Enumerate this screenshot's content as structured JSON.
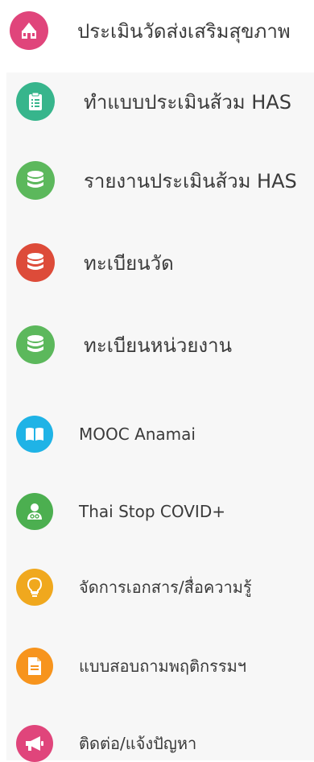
{
  "menu": {
    "items": [
      {
        "label": "ประเมินวัดส่งเสริมสุขภาพ",
        "icon": "temple-icon",
        "color": "#e0457b"
      },
      {
        "label": "ทำแบบประเมินส้วม HAS",
        "icon": "clipboard-icon",
        "color": "#37b58c"
      },
      {
        "label": "รายงานประเมินส้วม HAS",
        "icon": "database-icon",
        "color": "#5cb85c"
      },
      {
        "label": "ทะเบียนวัด",
        "icon": "database-icon",
        "color": "#dd4b39"
      },
      {
        "label": "ทะเบียนหน่วยงาน",
        "icon": "database-icon",
        "color": "#5cb85c"
      },
      {
        "label": "MOOC Anamai",
        "icon": "book-icon",
        "color": "#1fb3e6"
      },
      {
        "label": "Thai Stop COVID+",
        "icon": "user-group-icon",
        "color": "#4caf50"
      },
      {
        "label": "จัดการเอกสาร/สื่อความรู้",
        "icon": "lightbulb-icon",
        "color": "#f0a81e"
      },
      {
        "label": "แบบสอบถามพฤติกรรมฯ",
        "icon": "document-icon",
        "color": "#f7941d"
      },
      {
        "label": "ติดต่อ/แจ้งปัญหา",
        "icon": "megaphone-icon",
        "color": "#e0457b"
      }
    ]
  }
}
